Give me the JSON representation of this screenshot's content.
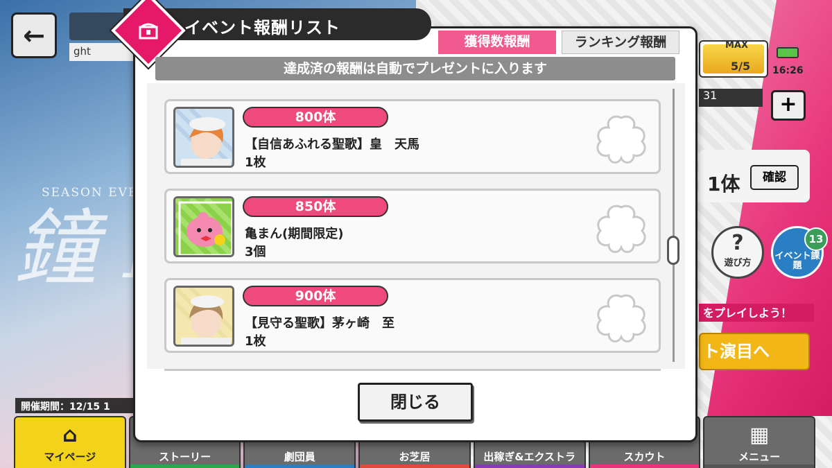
{
  "background": {
    "title_sub": "ght",
    "season_label": "SEASON EVEN",
    "script_title": "鐘 Ho",
    "period_label": "開催期間：12/15 1",
    "stamina": {
      "max_label": "MAX",
      "count": "5/5",
      "level_fraction": 1.0
    },
    "clock": "16:26",
    "dark_strip_text": "31",
    "plus_label": "+",
    "owned_count": "1体",
    "confirm_label": "確認",
    "help_label": "遊び方",
    "help_glyph": "?",
    "task_label": "イベント課題",
    "task_badge": "13",
    "play_banner": "をプレイしよう！",
    "perform_button": "ト演目へ"
  },
  "bottom_nav": {
    "items": [
      {
        "label": "マイページ",
        "icon": "house-icon",
        "glyph": "⌂",
        "underline": "#f3d21b"
      },
      {
        "label": "ストーリー",
        "icon": "",
        "glyph": "",
        "underline": "#2aa84a"
      },
      {
        "label": "劇団員",
        "icon": "",
        "glyph": "",
        "underline": "#2a7fc4"
      },
      {
        "label": "お芝居",
        "icon": "",
        "glyph": "",
        "underline": "#e04a3a"
      },
      {
        "label": "出稼ぎ&エクストラ",
        "icon": "",
        "glyph": "",
        "underline": "#8a3ab8"
      },
      {
        "label": "スカウト",
        "icon": "",
        "glyph": "",
        "underline": "#e8347a"
      },
      {
        "label": "メニュー",
        "icon": "grid-icon",
        "glyph": "▦",
        "underline": "#555555"
      }
    ]
  },
  "modal": {
    "title": "イベント報酬リスト",
    "header_icon": "treasure-chest-icon",
    "tabs": [
      {
        "label": "獲得数報酬",
        "active": true
      },
      {
        "label": "ランキング報酬",
        "active": false
      }
    ],
    "notice": "達成済の報酬は自動でプレゼントに入ります",
    "rewards": [
      {
        "threshold": "800体",
        "name": "【自信あふれる聖歌】皇　天馬",
        "quantity": "1枚",
        "thumb": "character-card-orange-hair"
      },
      {
        "threshold": "850体",
        "name": "亀まん(期間限定)",
        "quantity": "3個",
        "thumb": "kameman-item"
      },
      {
        "threshold": "900体",
        "name": "【見守る聖歌】茅ヶ崎　至",
        "quantity": "1枚",
        "thumb": "character-card-brown-hair"
      }
    ],
    "close_label": "閉じる"
  },
  "colors": {
    "accent_pink": "#ee4a7d",
    "header_dark": "#2b2b2b",
    "notice_gray": "#8d8d8d"
  }
}
